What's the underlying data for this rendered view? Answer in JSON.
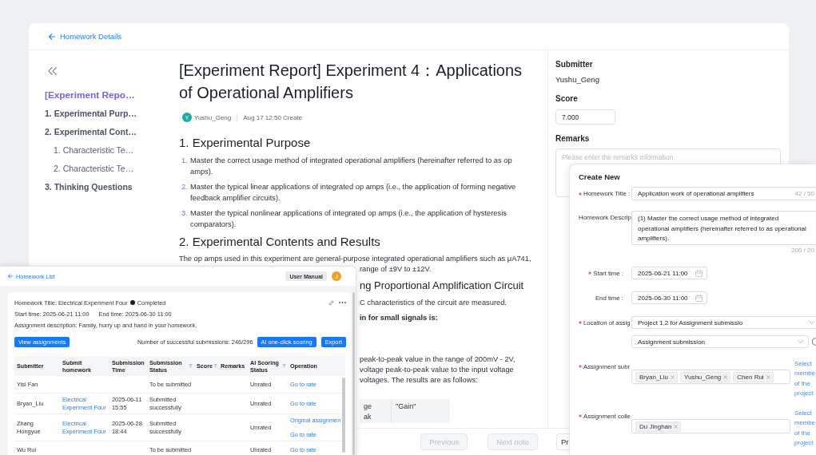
{
  "header": {
    "back_link": "Homework Details"
  },
  "outline": {
    "items": [
      {
        "label": "[Experiment Repo…",
        "selected": true
      },
      {
        "label": "1. Experimental Purp…",
        "selected": false
      },
      {
        "label": "2. Experimental Cont…",
        "selected": false,
        "children": [
          {
            "label": "1. Characteristic Te…",
            "selected": false
          },
          {
            "label": "2. Characteristic Te…",
            "selected": false
          }
        ]
      },
      {
        "label": "3. Thinking Questions",
        "selected": false
      }
    ]
  },
  "article": {
    "title": "[Experiment Report] Experiment 4：Applications of Operational Amplifiers",
    "author": {
      "initial": "Y",
      "name": "Yushu_Geng"
    },
    "created": "Aug 17 12:50 Create",
    "sections": [
      {
        "heading": "1. Experimental Purpose",
        "items": [
          {
            "number": "1.",
            "text": "Master the correct usage method of integrated operational amplifiers (hereinafter referred to as op amps)."
          },
          {
            "number": "2.",
            "text": "Master the typical linear applications of integrated op amps (i.e., the application of forming negative feedback amplifier circuits)."
          },
          {
            "number": "3.",
            "text": "Master the typical nonlinear applications of integrated op amps (i.e., the application of hysteresis comparators)."
          }
        ]
      },
      {
        "heading": "2. Experimental Contents and Results",
        "paragraph": "The op amps used in this experiment are general-purpose integrated operational amplifiers such as μA741,",
        "fragments": [
          {
            "kind": "text",
            "text": "range of ±9V to ±12V."
          },
          {
            "kind": "heading",
            "text": "ng Proportional Amplification Circuit"
          },
          {
            "kind": "text",
            "text": "C characteristics of the circuit are measured."
          },
          {
            "kind": "bold",
            "text": "in for small signals is:"
          },
          {
            "kind": "text",
            "text": "peak-to-peak value in the range of 200mV - 2V,\nvoltage peak-to-peak value to the input voltage\nvoltages. The results are as follows:"
          },
          {
            "kind": "table",
            "cells": [
              "ge\nak",
              "\"Gain\""
            ]
          }
        ]
      }
    ]
  },
  "review": {
    "submitter": {
      "label": "Submitter",
      "value": "Yushu_Geng"
    },
    "score": {
      "label": "Score",
      "value": "7.000"
    },
    "remarks": {
      "label": "Remarks",
      "placeholder": "Please enter the remarks information"
    }
  },
  "footer": {
    "previous": {
      "label": "Previous",
      "disabled": true
    },
    "next": {
      "label": "Next note",
      "disabled": true
    },
    "side_button": {
      "label": "Pr"
    }
  },
  "homework_list": {
    "back_link": "Homework List",
    "manual_button": "User Manual",
    "avatar": "J",
    "title": "Homework Title: Electrical Experiment Four",
    "status": "Completed",
    "start_time": "Start time: 2025-06-21 11:00",
    "end_time": "End time: 2025-06-30 11:00",
    "description": "Assignment description: Family, hurry up and hand in your homework.",
    "view_button": "View assignments",
    "submission_count": "Number of successful submissions: 246/296",
    "ai_button": "AI one-click scoring",
    "export_button": "Export",
    "table": {
      "columns": [
        {
          "label": "Submitter",
          "filterable": false
        },
        {
          "label": "Submit homework",
          "filterable": false
        },
        {
          "label": "Submission Time",
          "filterable": false
        },
        {
          "label": "Submission Status",
          "filterable": true
        },
        {
          "label": "Score",
          "filterable": true
        },
        {
          "label": "Remarks",
          "filterable": false
        },
        {
          "label": "AI Scoring Status",
          "filterable": true
        },
        {
          "label": "Operation",
          "filterable": false
        }
      ],
      "rows": [
        {
          "submitter": "Yisi Fan",
          "status": "To be submitted",
          "ai_status": "Unrated",
          "operations": [
            "Go to rate"
          ]
        },
        {
          "submitter": "Bryan_Liu",
          "homework": "Electrical Experiment Four",
          "time": "2025-06-11 15:55",
          "status": "Submitted successfully",
          "ai_status": "Unrated",
          "operations": [
            "Go to rate"
          ]
        },
        {
          "submitter": "Zhang Hongyue",
          "homework": "Electrical Experiment Four",
          "time": "2025-06-28 18:44",
          "status": "Submitted successfully",
          "ai_status": "Unrated",
          "operations": [
            "Original assignmen",
            "Go to rate"
          ]
        },
        {
          "submitter": "Wu Rui",
          "status": "To be submitted",
          "ai_status": "Unrated",
          "operations": [
            "Go to rate"
          ]
        }
      ]
    }
  },
  "create_new": {
    "title": "Create New",
    "fields": [
      {
        "kind": "input",
        "required": true,
        "label": "Homework Title :",
        "value": "Application work of operational amplifiers",
        "count": "42 / 50"
      },
      {
        "kind": "textarea",
        "required": false,
        "label": "Homework Descrip",
        "value": "(1) Master the correct usage method of integrated\noperational amplifiers (hereinafter referred to as operational\namplifiers).",
        "count": "200 / 20"
      },
      {
        "kind": "date",
        "required": true,
        "label": "Start time :",
        "value": "2025-06-21 11:00"
      },
      {
        "kind": "date",
        "required": false,
        "label": "End time :",
        "value": "2025-06-30 11:00"
      },
      {
        "kind": "select",
        "required": true,
        "label": "Location of assig",
        "value": "Project 1.2 for Assignment submissio"
      },
      {
        "kind": "sub_select",
        "required": false,
        "value": "Assignment submission"
      },
      {
        "kind": "members",
        "required": true,
        "label": "Assignment subr",
        "tags": [
          "Bryan_Liu",
          "Yushu_Geng",
          "Chen Rui"
        ],
        "link": "Select\nmembe\nof the\nproject"
      },
      {
        "kind": "members",
        "required": true,
        "label": "Assignment colle",
        "tags": [
          "Du Jinghan"
        ],
        "link": "Select\nmembe\nof the\nproject"
      }
    ]
  }
}
